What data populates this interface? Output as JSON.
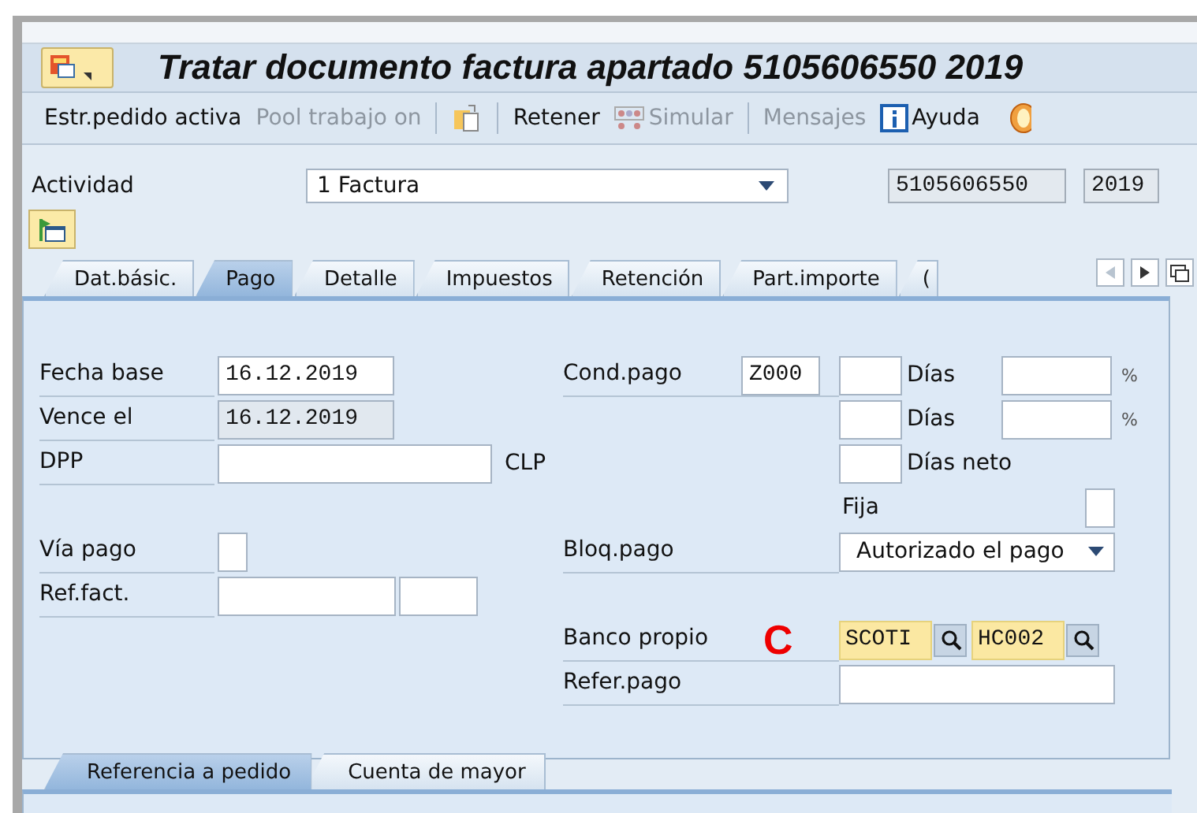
{
  "window": {
    "title": "Tratar documento factura apartado 5105606550 2019"
  },
  "toolbar": [
    {
      "kind": "text",
      "label": "Estr.pedido activa",
      "disabled": false
    },
    {
      "kind": "text",
      "label": "Pool trabajo on",
      "disabled": true
    },
    {
      "kind": "separator"
    },
    {
      "kind": "icon",
      "disabled": false
    },
    {
      "kind": "separator"
    },
    {
      "kind": "text",
      "label": "Retener",
      "disabled": false
    },
    {
      "kind": "simulate",
      "label": "Simular",
      "disabled": true
    },
    {
      "kind": "separator"
    },
    {
      "kind": "text",
      "label": "Mensajes",
      "disabled": true
    },
    {
      "kind": "help",
      "label": "Ayuda",
      "disabled": false
    },
    {
      "kind": "coin",
      "disabled": false
    }
  ],
  "header": {
    "label": "Actividad",
    "value": "1 Factura",
    "document": "5105606550",
    "year": "2019"
  },
  "tabs": [
    {
      "label": "Dat.básic.",
      "selected": false
    },
    {
      "label": "Pago",
      "selected": true
    },
    {
      "label": "Detalle",
      "selected": false
    },
    {
      "label": "Impuestos",
      "selected": false
    },
    {
      "label": "Retención",
      "selected": false
    },
    {
      "label": "Part.importe",
      "selected": false
    },
    {
      "label": "(",
      "selected": false
    }
  ],
  "left_rows": [
    {
      "label": "Fecha base",
      "cells": [
        {
          "kind": "date",
          "value": "16.12.2019",
          "readonly": false
        }
      ]
    },
    {
      "label": "Vence el",
      "cells": [
        {
          "kind": "date",
          "value": "16.12.2019",
          "readonly": true
        }
      ]
    },
    {
      "label": "DPP",
      "cells": [
        {
          "kind": "amount",
          "readonly": false
        },
        {
          "kind": "unit",
          "value": "CLP"
        }
      ]
    },
    {
      "cells": []
    },
    {
      "label": "Vía pago",
      "cells": [
        {
          "kind": "tiny",
          "readonly": false
        }
      ]
    },
    {
      "label": "Ref.fact.",
      "cells": [
        {
          "kind": "ref",
          "readonly": false
        },
        {
          "kind": "ref2",
          "readonly": false
        }
      ]
    }
  ],
  "right_rows": [
    {
      "label": "Cond.pago",
      "cells": [
        {
          "kind": "code",
          "value": "Z000",
          "readonly": false
        },
        {
          "kind": "days",
          "readonly": false
        },
        {
          "kind": "unit",
          "value": "Días"
        },
        {
          "kind": "pct_field",
          "readonly": false
        },
        {
          "kind": "pct",
          "value": "%"
        }
      ]
    },
    {
      "cells": [
        {
          "kind": "days",
          "readonly": false
        },
        {
          "kind": "unit",
          "value": "Días"
        },
        {
          "kind": "pct_field",
          "readonly": false
        },
        {
          "kind": "pct",
          "value": "%"
        }
      ]
    },
    {
      "cells": [
        {
          "kind": "days",
          "readonly": false
        },
        {
          "kind": "unit_wide",
          "value": "Días neto"
        }
      ]
    },
    {
      "cells": [
        {
          "kind": "sublabel",
          "value": "Fija"
        },
        {
          "kind": "checkbox",
          "checked": false
        }
      ]
    },
    {
      "label": "Bloq.pago",
      "cells": [
        {
          "kind": "dropdown",
          "value": "Autorizado el pago"
        }
      ]
    },
    {
      "cells": []
    },
    {
      "label": "Banco propio",
      "cells": [
        {
          "kind": "marker",
          "value": "C"
        },
        {
          "kind": "search_field",
          "value": "SCOTI",
          "highlighted": true
        },
        {
          "kind": "search_field",
          "value": "HC002",
          "highlighted": true
        }
      ]
    },
    {
      "label": "Refer.pago",
      "cells": [
        {
          "kind": "wide",
          "readonly": false
        }
      ]
    }
  ],
  "bottom_tabs": [
    {
      "label": "Referencia a pedido",
      "selected": true
    },
    {
      "label": "Cuenta de mayor",
      "selected": false
    }
  ]
}
